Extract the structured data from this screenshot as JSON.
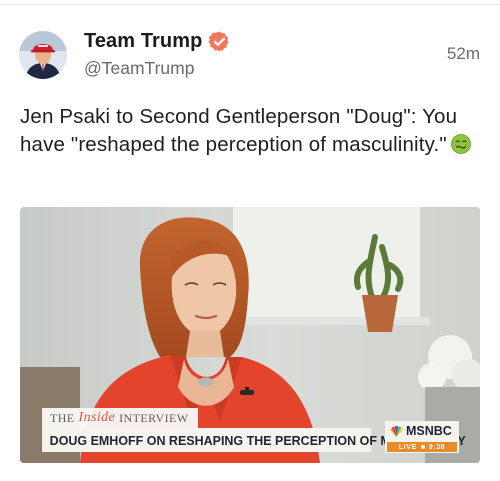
{
  "post": {
    "author": {
      "display_name": "Team Trump",
      "handle": "@TeamTrump",
      "verified": true,
      "verified_color": "#f4785b",
      "avatar": "profile-photo-icon"
    },
    "timestamp": "52m",
    "text": "Jen Psaki to Second Gentleperson \"Doug\": You have \"reshaped the perception of masculinity.\"",
    "emoji": "nauseated-face-icon"
  },
  "media": {
    "type": "video-still",
    "lower_third": {
      "series_prefix": "THE",
      "series_name": "Inside",
      "series_suffix": "INTERVIEW",
      "headline": "DOUG EMHOFF ON RESHAPING THE PERCEPTION OF MASCULINITY",
      "network": "MSNBC",
      "live_label": "LIVE",
      "time": "9:38",
      "accent_color": "#e88b2a"
    }
  },
  "colors": {
    "background": "#ffffff",
    "text_primary": "#1f1f1f",
    "text_secondary": "#6b6b6b"
  }
}
